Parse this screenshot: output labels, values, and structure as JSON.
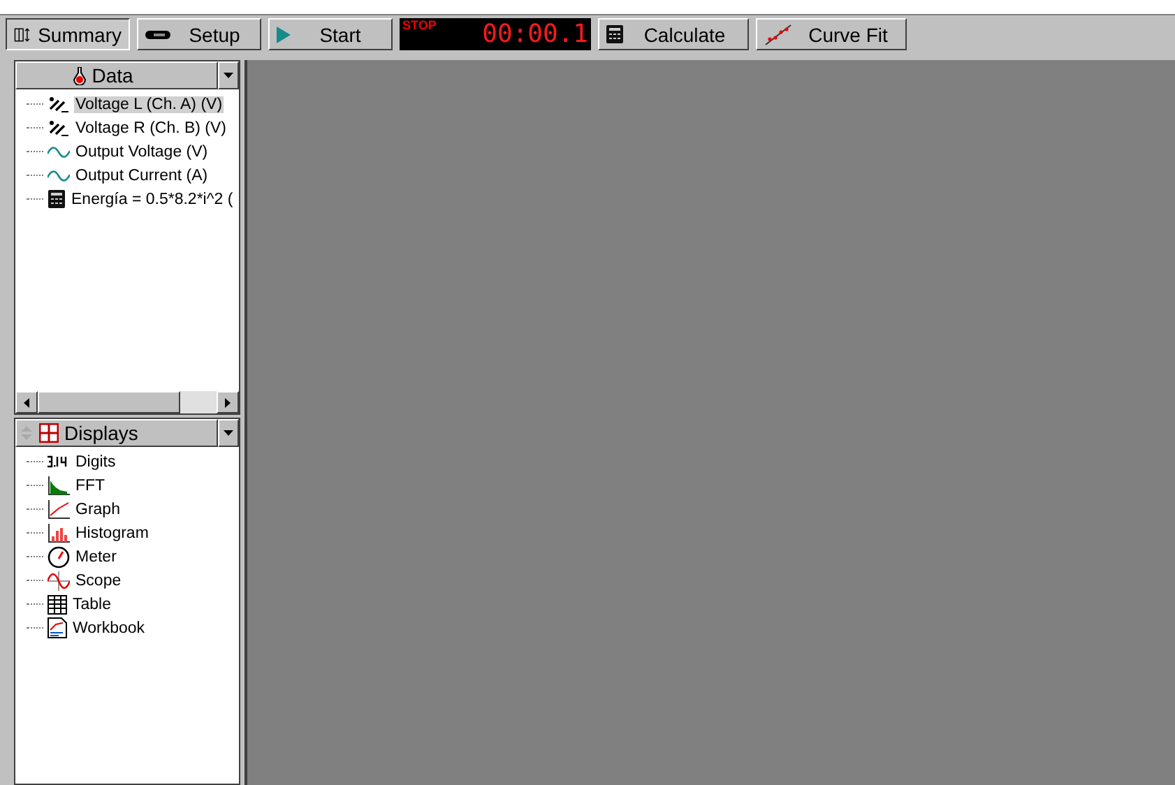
{
  "toolbar": {
    "buttons": [
      {
        "label": "Summary",
        "kind": "summary",
        "selected": true
      },
      {
        "label": "Setup",
        "kind": "setup",
        "selected": false
      },
      {
        "label": "Start",
        "kind": "start",
        "selected": false
      }
    ],
    "timer": {
      "status": "STOP",
      "time": "00:00.1"
    },
    "tools": [
      {
        "label": "Calculate",
        "kind": "calculate"
      },
      {
        "label": "Curve Fit",
        "kind": "curvefit"
      }
    ]
  },
  "data_panel": {
    "title": "Data",
    "items": [
      {
        "label": "Voltage L (Ch. A) (V)",
        "kind": "sensor",
        "selected": true
      },
      {
        "label": "Voltage R (Ch. B) (V)",
        "kind": "sensor",
        "selected": false
      },
      {
        "label": "Output Voltage (V)",
        "kind": "wave",
        "selected": false
      },
      {
        "label": "Output Current (A)",
        "kind": "wave",
        "selected": false
      },
      {
        "label": "Energía = 0.5*8.2*i^2 (",
        "kind": "calc",
        "selected": false
      }
    ]
  },
  "displays_panel": {
    "title": "Displays",
    "items": [
      {
        "label": "Digits",
        "kind": "digits"
      },
      {
        "label": "FFT",
        "kind": "fft"
      },
      {
        "label": "Graph",
        "kind": "graph"
      },
      {
        "label": "Histogram",
        "kind": "histogram"
      },
      {
        "label": "Meter",
        "kind": "meter"
      },
      {
        "label": "Scope",
        "kind": "scope"
      },
      {
        "label": "Table",
        "kind": "table"
      },
      {
        "label": "Workbook",
        "kind": "workbook"
      }
    ]
  }
}
